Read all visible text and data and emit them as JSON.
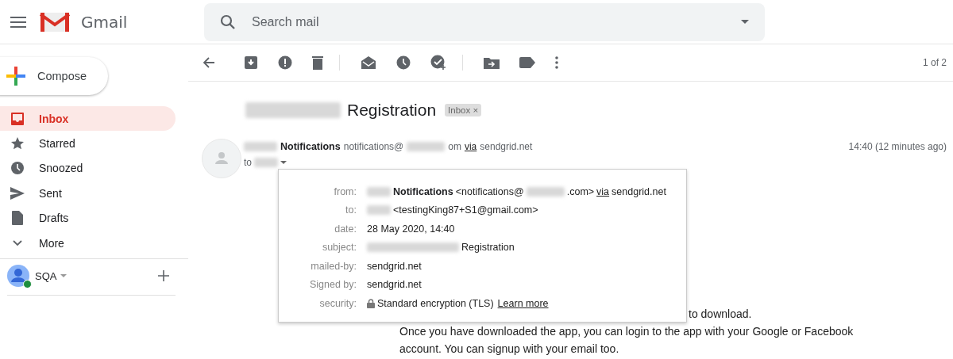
{
  "app": {
    "name": "Gmail"
  },
  "search": {
    "placeholder": "Search mail"
  },
  "compose": {
    "label": "Compose"
  },
  "sidebar": {
    "items": [
      {
        "label": "Inbox",
        "selected": true
      },
      {
        "label": "Starred",
        "selected": false
      },
      {
        "label": "Snoozed",
        "selected": false
      },
      {
        "label": "Sent",
        "selected": false
      },
      {
        "label": "Drafts",
        "selected": false
      },
      {
        "label": "More",
        "selected": false
      }
    ]
  },
  "account": {
    "name": "SQA",
    "online": true
  },
  "toolbar": {
    "pager": "1 of 2"
  },
  "message": {
    "subject": "Registration",
    "label_chip": "Inbox",
    "chip_close": "×",
    "sender_name": "Notifications",
    "sender_email_start": "notifications@",
    "sender_email_end": "om",
    "via": "via",
    "via_domain": "sendgrid.net",
    "to_prefix": "to",
    "time": "14:40 (12 minutes ago)",
    "details": [
      {
        "kind": "from",
        "label": "from:",
        "name": "Notifications",
        "email_start": "<notifications@",
        "email_end": ".com>",
        "via": "via",
        "via_domain": "sendgrid.net"
      },
      {
        "kind": "to",
        "label": "to:",
        "value": "<testingKing87+S1@gmail.com>"
      },
      {
        "kind": "plain",
        "label": "date:",
        "value": "28 May 2020, 14:40"
      },
      {
        "kind": "subject",
        "label": "subject:",
        "value": "Registration"
      },
      {
        "kind": "plain",
        "label": "mailed-by:",
        "value": "sendgrid.net"
      },
      {
        "kind": "plain",
        "label": "Signed by:",
        "value": "sendgrid.net"
      },
      {
        "kind": "security",
        "label": "security:",
        "value": "Standard encryption (TLS)",
        "link": "Learn more"
      }
    ],
    "body": [
      "to download.",
      "Once you have downloaded the app, you can login to the app with your Google or Facebook",
      "account. You can signup with your email too."
    ]
  }
}
